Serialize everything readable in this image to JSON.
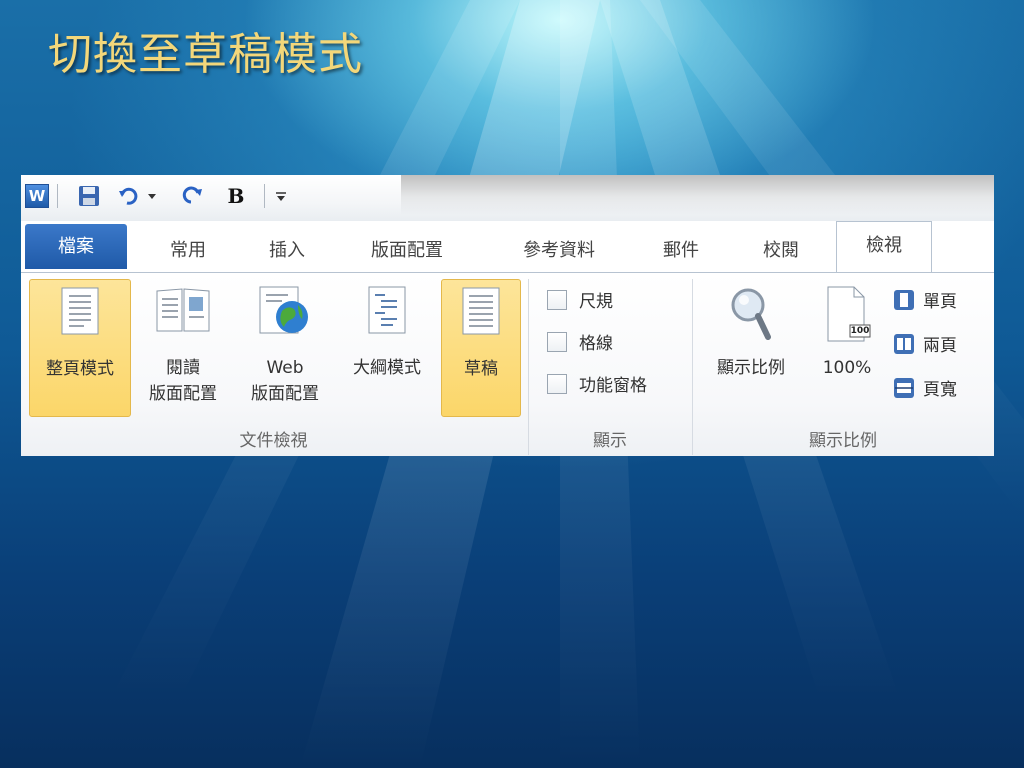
{
  "slide": {
    "title": "切換至草稿模式"
  },
  "qat": {
    "bold_label": "B",
    "app_logo": "W"
  },
  "tabs": [
    {
      "label": "檔案"
    },
    {
      "label": "常用"
    },
    {
      "label": "插入"
    },
    {
      "label": "版面配置"
    },
    {
      "label": "參考資料"
    },
    {
      "label": "郵件"
    },
    {
      "label": "校閱"
    },
    {
      "label": "檢視"
    }
  ],
  "ribbon": {
    "document_views": {
      "group_label": "文件檢視",
      "print_layout": "整頁模式",
      "reading_line1": "閱讀",
      "reading_line2": "版面配置",
      "web_line1": "Web",
      "web_line2": "版面配置",
      "outline": "大綱模式",
      "draft": "草稿"
    },
    "show": {
      "group_label": "顯示",
      "ruler": "尺規",
      "gridlines": "格線",
      "nav_pane": "功能窗格"
    },
    "zoom": {
      "group_label": "顯示比例",
      "zoom_label": "顯示比例",
      "hundred_label": "100%",
      "hundred_icon_text": "100",
      "one_page": "單頁",
      "two_pages": "兩頁",
      "page_width": "頁寬"
    }
  },
  "colors": {
    "title": "#f3d77a",
    "file_tab": "#1f5aa8",
    "selected_button": "#fbd669"
  }
}
